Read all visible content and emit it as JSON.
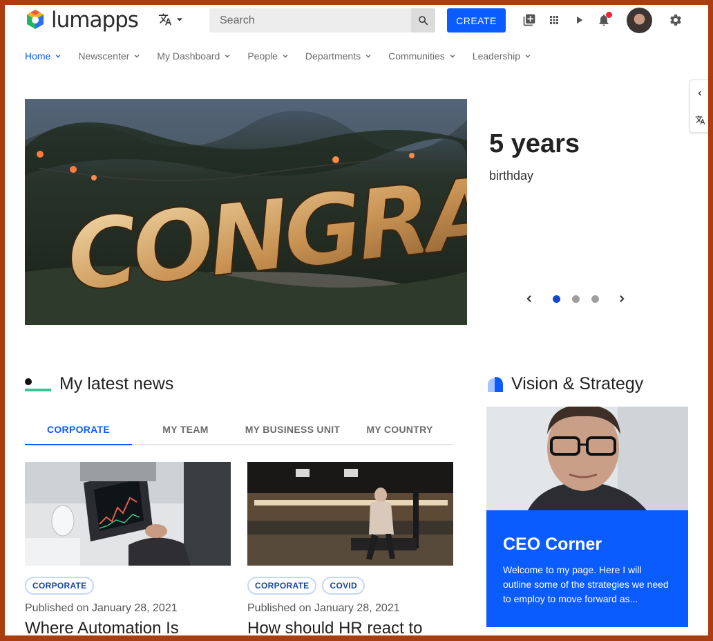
{
  "brand": {
    "name": "lumapps",
    "accent": "#0a5cff",
    "frame_color": "#ab3e10"
  },
  "header": {
    "search_placeholder": "Search",
    "create_label": "CREATE",
    "icons": [
      "translate-icon",
      "chevron-down-icon",
      "search-icon",
      "library-icon",
      "apps-grid-icon",
      "play-icon",
      "bell-icon",
      "settings-icon"
    ],
    "notification_indicator": true
  },
  "nav": {
    "items": [
      {
        "label": "Home",
        "active": true
      },
      {
        "label": "Newscenter"
      },
      {
        "label": "My Dashboard"
      },
      {
        "label": "People"
      },
      {
        "label": "Departments"
      },
      {
        "label": "Communities"
      },
      {
        "label": "Leadership"
      }
    ]
  },
  "hero": {
    "image_text": "CONGRATS",
    "title": "5 years",
    "subtitle": "birthday",
    "slides_total": 3,
    "active_slide": 1
  },
  "news": {
    "title": "My latest news",
    "tabs": [
      "CORPORATE",
      "MY TEAM",
      "MY BUSINESS UNIT",
      "MY COUNTRY"
    ],
    "active_tab": "CORPORATE",
    "cards": [
      {
        "tags": [
          "CORPORATE"
        ],
        "published": "Published on January 28, 2021",
        "title": "Where Automation Is"
      },
      {
        "tags": [
          "CORPORATE",
          "COVID"
        ],
        "published": "Published on January 28, 2021",
        "title": "How should HR react to"
      }
    ]
  },
  "vision": {
    "title": "Vision & Strategy",
    "ceo_title": "CEO Corner",
    "ceo_text": "Welcome to my page. Here I will outline some of the strategies we need to employ to move forward as..."
  }
}
